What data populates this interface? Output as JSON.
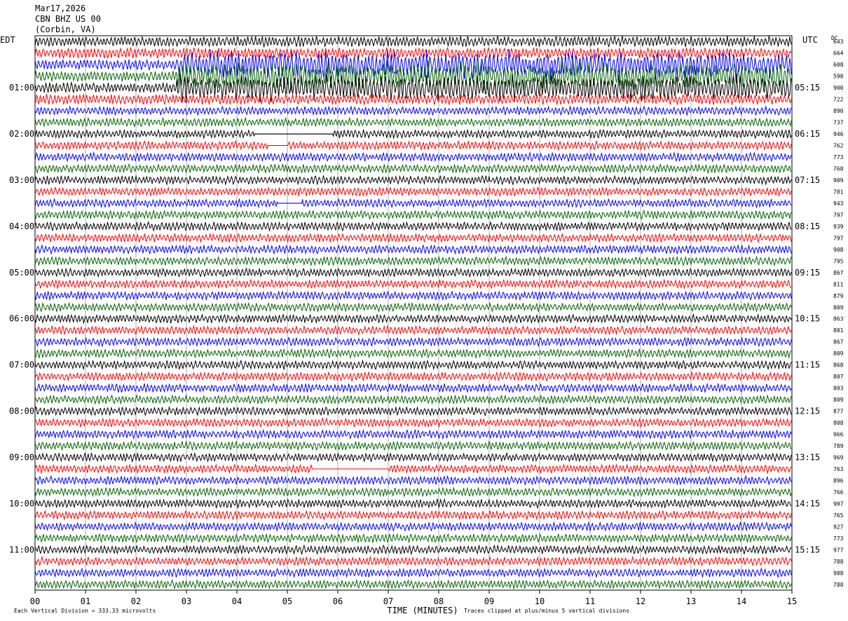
{
  "header": {
    "date": "Mar17,2026",
    "station": "CBN BHZ US 00",
    "location": "(Corbin, VA)"
  },
  "chart_data": {
    "type": "line",
    "subtype": "helicorder",
    "left_axis_label": "EDT",
    "right_axis_label": "UTC",
    "dc_label": "DC",
    "left_hour_labels": [
      "01:00",
      "02:00",
      "03:00",
      "04:00",
      "05:00",
      "06:00",
      "07:00",
      "08:00",
      "09:00",
      "10:00",
      "11:00"
    ],
    "right_hour_labels": [
      "05:15",
      "06:15",
      "07:15",
      "08:15",
      "09:15",
      "10:15",
      "11:15",
      "12:15",
      "13:15",
      "14:15",
      "15:15"
    ],
    "x_ticks": [
      "00",
      "01",
      "02",
      "03",
      "04",
      "05",
      "06",
      "07",
      "08",
      "09",
      "10",
      "11",
      "12",
      "13",
      "14",
      "15"
    ],
    "xlabel": "TIME (MINUTES)",
    "xlim": [
      0,
      15
    ],
    "trace_count": 48,
    "trace_colors": [
      "#000000",
      "#ff0000",
      "#0000ff",
      "#006400"
    ],
    "dc_offsets": [
      "643",
      "664",
      "608",
      "598",
      "900",
      "722",
      "890",
      "737",
      "946",
      "762",
      "773",
      "768",
      "909",
      "781",
      "943",
      "797",
      "939",
      "797",
      "908",
      "795",
      "867",
      "811",
      "879",
      "809",
      "863",
      "801",
      "867",
      "809",
      "868",
      "807",
      "803",
      "809",
      "877",
      "808",
      "966",
      "789",
      "969",
      "763",
      "896",
      "766",
      "907",
      "765",
      "927",
      "773",
      "977",
      "788",
      "988",
      "788"
    ],
    "gaps": [
      {
        "trace": 8,
        "start_min": 4.35,
        "end_min": 5.9
      },
      {
        "trace": 9,
        "start_min": 4.6,
        "end_min": 5.0
      },
      {
        "trace": 14,
        "start_min": 4.8,
        "end_min": 5.3
      },
      {
        "trace": 37,
        "start_min": 5.5,
        "end_min": 7.0
      }
    ],
    "footer_left": "Each Vertical Division =  333.33 microvolts",
    "footer_right": "Traces clipped at plus/minus 5 vertical divisions"
  }
}
